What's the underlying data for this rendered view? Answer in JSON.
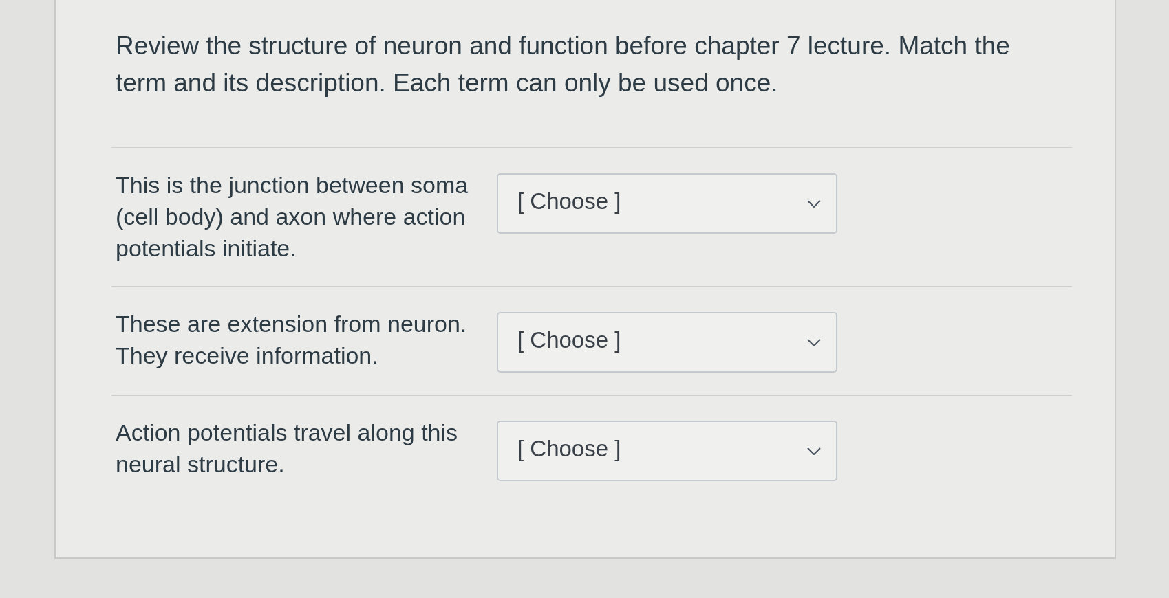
{
  "question": {
    "text": "Review the structure of neuron and function before chapter 7 lecture. Match the term and its description. Each term can only be used once."
  },
  "matches": [
    {
      "description": "This is the junction between soma (cell body) and axon where action potentials initiate.",
      "select": {
        "value": "[ Choose ]"
      }
    },
    {
      "description": "These are extension from neuron. They receive information.",
      "select": {
        "value": "[ Choose ]"
      }
    },
    {
      "description": "Action potentials travel along this neural structure.",
      "select": {
        "value": "[ Choose ]"
      }
    }
  ]
}
